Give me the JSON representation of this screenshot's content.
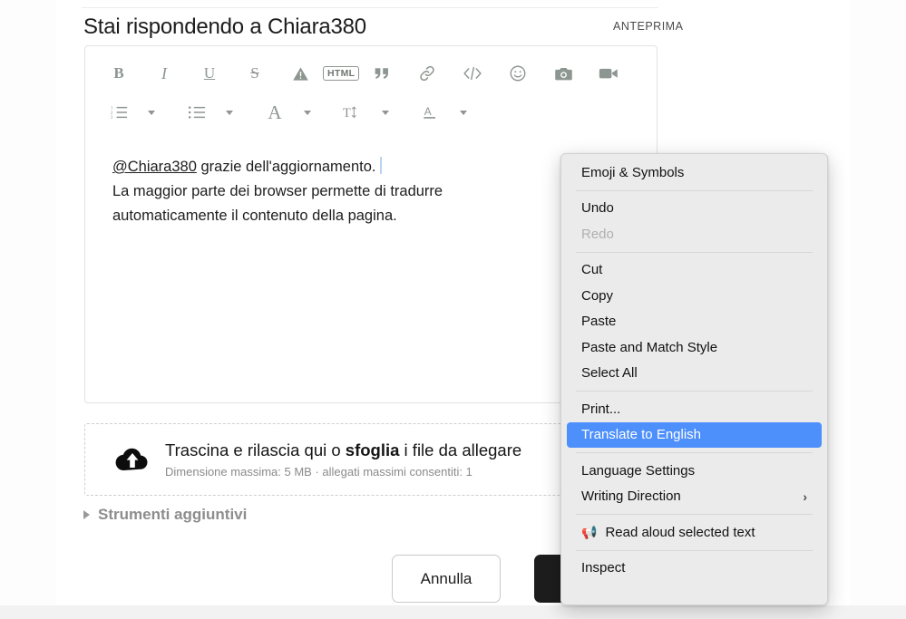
{
  "header": {
    "title": "Stai rispondendo a Chiara380",
    "preview_label": "ANTEPRIMA"
  },
  "toolbar": {
    "row1": [
      {
        "name": "bold-button",
        "label": "B",
        "icon": "bold-icon"
      },
      {
        "name": "italic-button",
        "label": "I",
        "icon": "italic-icon"
      },
      {
        "name": "underline-button",
        "label": "U",
        "icon": "underline-icon"
      },
      {
        "name": "strikethrough-button",
        "label": "S",
        "icon": "strikethrough-icon"
      },
      {
        "name": "spoiler-button",
        "label": "",
        "icon": "warning-triangle-icon"
      },
      {
        "name": "html-button",
        "label": "HTML",
        "icon": "html-icon"
      },
      {
        "name": "quote-button",
        "label": "",
        "icon": "quote-icon"
      },
      {
        "name": "link-button",
        "label": "",
        "icon": "link-icon"
      },
      {
        "name": "code-button",
        "label": "",
        "icon": "code-icon"
      },
      {
        "name": "emoji-button",
        "label": "",
        "icon": "smiley-icon"
      },
      {
        "name": "image-button",
        "label": "",
        "icon": "camera-icon"
      },
      {
        "name": "video-button",
        "label": "",
        "icon": "video-camera-icon"
      }
    ],
    "row2": [
      {
        "name": "ordered-list-button",
        "icon": "ordered-list-icon",
        "caret": "chevron-down-icon"
      },
      {
        "name": "bullet-list-button",
        "icon": "bullet-list-icon",
        "caret": "chevron-down-icon"
      },
      {
        "name": "font-family-button",
        "icon": "font-letter-a-icon",
        "caret": "chevron-down-icon"
      },
      {
        "name": "font-size-button",
        "icon": "text-size-icon",
        "caret": "chevron-down-icon"
      },
      {
        "name": "font-color-button",
        "icon": "font-color-a-icon",
        "caret": "chevron-down-icon"
      }
    ]
  },
  "editor": {
    "mention": "@Chiara380",
    "line1_rest": " grazie dell'aggiornamento.",
    "line2": "La maggior parte dei browser permette di tradurre",
    "line3": "automaticamente il contenuto della pagina."
  },
  "dropzone": {
    "icon": "cloud-upload-icon",
    "title_pre": "Trascina e rilascia qui o ",
    "title_link": "sfoglia",
    "title_post": " i file da allegare",
    "subtitle": "Dimensione massima: 5 MB · allegati massimi consentiti: 1"
  },
  "extras": {
    "label": "Strumenti aggiuntivi",
    "icon": "disclosure-triangle-icon"
  },
  "footer": {
    "cancel_label": "Annulla",
    "submit_label": ""
  },
  "context_menu": {
    "items": [
      {
        "type": "item",
        "name": "ctx-emoji-symbols",
        "label": "Emoji & Symbols"
      },
      {
        "type": "sep"
      },
      {
        "type": "item",
        "name": "ctx-undo",
        "label": "Undo"
      },
      {
        "type": "item",
        "name": "ctx-redo",
        "label": "Redo",
        "state": "disabled"
      },
      {
        "type": "sep"
      },
      {
        "type": "item",
        "name": "ctx-cut",
        "label": "Cut"
      },
      {
        "type": "item",
        "name": "ctx-copy",
        "label": "Copy"
      },
      {
        "type": "item",
        "name": "ctx-paste",
        "label": "Paste"
      },
      {
        "type": "item",
        "name": "ctx-paste-match-style",
        "label": "Paste and Match Style"
      },
      {
        "type": "item",
        "name": "ctx-select-all",
        "label": "Select All"
      },
      {
        "type": "sep"
      },
      {
        "type": "item",
        "name": "ctx-print",
        "label": "Print..."
      },
      {
        "type": "item",
        "name": "ctx-translate",
        "label": "Translate to English",
        "state": "highlight"
      },
      {
        "type": "sep"
      },
      {
        "type": "item",
        "name": "ctx-language-settings",
        "label": "Language Settings"
      },
      {
        "type": "item",
        "name": "ctx-writing-direction",
        "label": "Writing Direction",
        "submenu": "›"
      },
      {
        "type": "sep"
      },
      {
        "type": "item",
        "name": "ctx-read-aloud",
        "label": "Read aloud selected text",
        "emoji": "📢"
      },
      {
        "type": "sep"
      },
      {
        "type": "item",
        "name": "ctx-inspect",
        "label": "Inspect"
      }
    ]
  },
  "colors": {
    "highlight": "#4d8ffb",
    "menu_bg": "#ebebeb",
    "submit_bg": "#1d1d1d",
    "toolbar_icon": "#8e9691"
  }
}
